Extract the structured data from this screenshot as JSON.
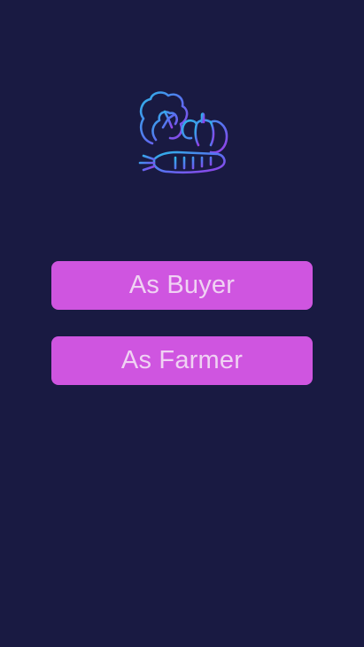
{
  "app": {
    "logo_icon": "vegetables-icon",
    "background_color": "#191a42",
    "accent_color": "#cf55e0"
  },
  "role_selection": {
    "buyer_label": "As Buyer",
    "farmer_label": "As Farmer"
  }
}
